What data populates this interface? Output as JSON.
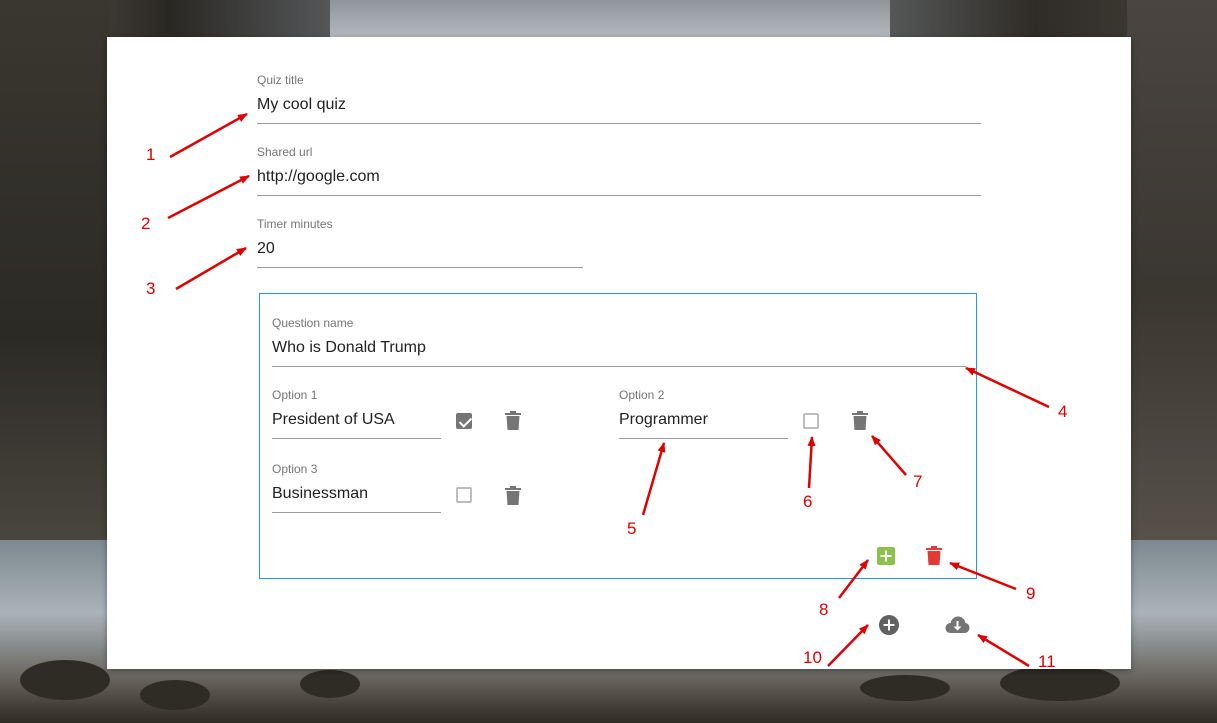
{
  "form": {
    "quiz_title": {
      "label": "Quiz title",
      "value": "My cool quiz"
    },
    "shared_url": {
      "label": "Shared url",
      "value": "http://google.com"
    },
    "timer_minutes": {
      "label": "Timer minutes",
      "value": "20"
    }
  },
  "question": {
    "name": {
      "label": "Question name",
      "value": "Who is Donald Trump"
    },
    "options": [
      {
        "label": "Option 1",
        "value": "President of USA",
        "correct": true
      },
      {
        "label": "Option 2",
        "value": "Programmer",
        "correct": false
      },
      {
        "label": "Option 3",
        "value": "Businessman",
        "correct": false
      }
    ],
    "actions": {
      "add_option_icon": "add-box-icon",
      "delete_question_icon": "trash-icon"
    }
  },
  "footer_actions": {
    "add_question_icon": "add-circle-icon",
    "save_icon": "cloud-download-icon"
  },
  "annotations": [
    "1",
    "2",
    "3",
    "4",
    "5",
    "6",
    "7",
    "8",
    "9",
    "10",
    "11"
  ],
  "colors": {
    "accent_border": "#2196f3",
    "add_green": "#8bc34a",
    "delete_red": "#e53935",
    "annotation_red": "#e00000"
  }
}
